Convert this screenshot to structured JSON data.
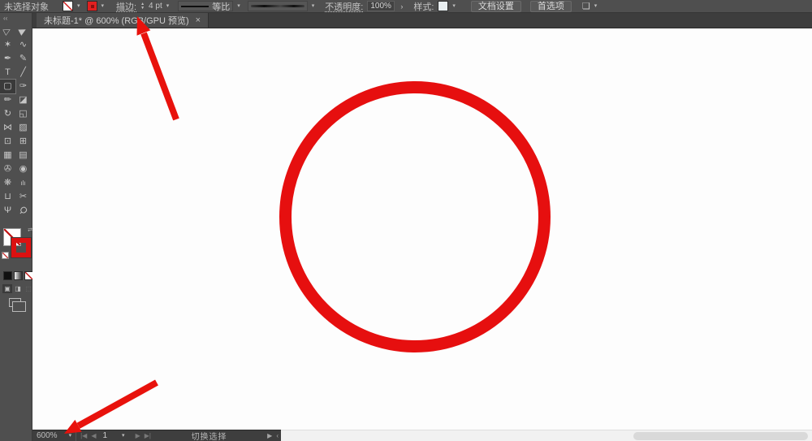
{
  "colors": {
    "accent_red": "#e60f0f",
    "arrow_red": "#e8120c"
  },
  "control_bar": {
    "no_selection_label": "未选择对象",
    "stroke_label": "描边:",
    "stroke_weight_value": "4 pt",
    "width_profile_value": "等比",
    "opacity_label": "不透明度:",
    "opacity_value": "100%",
    "opacity_more_glyph": "›",
    "style_label": "样式:",
    "document_setup_button": "文档设置",
    "preferences_button": "首选项"
  },
  "icons": {
    "chevron": "▾",
    "stepper_up": "▲",
    "stepper_down": "▼",
    "close": "×",
    "collapse": "‹‹",
    "swap": "⇄",
    "arrange_windows": "❏",
    "first_artboard": "|◀",
    "prev_artboard": "◀",
    "next_artboard": "▶",
    "last_artboard": "▶|",
    "status_flyout": "▶",
    "status_back": "‹",
    "draw_normal": "▣",
    "draw_behind": "◨",
    "draw_inside": "⬚"
  },
  "tab_bar": {
    "document_tab_title": "未标题-1* @ 600% (RGB/GPU 预览)"
  },
  "tools": [
    {
      "name": "selection-tool",
      "glyph": "▷",
      "cls": "rot"
    },
    {
      "name": "direct-selection-tool",
      "glyph": "▶",
      "cls": "rot"
    },
    {
      "name": "magic-wand-tool",
      "glyph": "✶"
    },
    {
      "name": "lasso-tool",
      "glyph": "∿"
    },
    {
      "name": "pen-tool",
      "glyph": "✒"
    },
    {
      "name": "curvature-tool",
      "glyph": "✎"
    },
    {
      "name": "type-tool",
      "glyph": "T"
    },
    {
      "name": "line-segment-tool",
      "glyph": "╱"
    },
    {
      "name": "rectangle-tool",
      "glyph": "▢",
      "selected": true
    },
    {
      "name": "paintbrush-tool",
      "glyph": "✑"
    },
    {
      "name": "pencil-tool",
      "glyph": "✏"
    },
    {
      "name": "eraser-tool",
      "glyph": "◪"
    },
    {
      "name": "rotate-tool",
      "glyph": "↻"
    },
    {
      "name": "scale-tool",
      "glyph": "◱"
    },
    {
      "name": "width-tool",
      "glyph": "⋈"
    },
    {
      "name": "free-transform-tool",
      "glyph": "▨"
    },
    {
      "name": "shape-builder-tool",
      "glyph": "⊡"
    },
    {
      "name": "perspective-grid-tool",
      "glyph": "⊞"
    },
    {
      "name": "mesh-tool",
      "glyph": "▦"
    },
    {
      "name": "gradient-tool",
      "glyph": "▤"
    },
    {
      "name": "eyedropper-tool",
      "glyph": "✇"
    },
    {
      "name": "blend-tool",
      "glyph": "◉"
    },
    {
      "name": "symbol-sprayer-tool",
      "glyph": "❋"
    },
    {
      "name": "column-graph-tool",
      "glyph": "ılı",
      "cls": "small"
    },
    {
      "name": "artboard-tool",
      "glyph": "⊔"
    },
    {
      "name": "slice-tool",
      "glyph": "✂"
    },
    {
      "name": "hand-tool",
      "glyph": "Ψ"
    },
    {
      "name": "zoom-tool",
      "glyph": "Ϙ",
      "cls": "rot45"
    }
  ],
  "canvas": {
    "circle_stroke_color": "#e60f0f"
  },
  "status_bar": {
    "zoom_value": "600%",
    "artboard_value": "1",
    "hint_text": "切换选择"
  }
}
